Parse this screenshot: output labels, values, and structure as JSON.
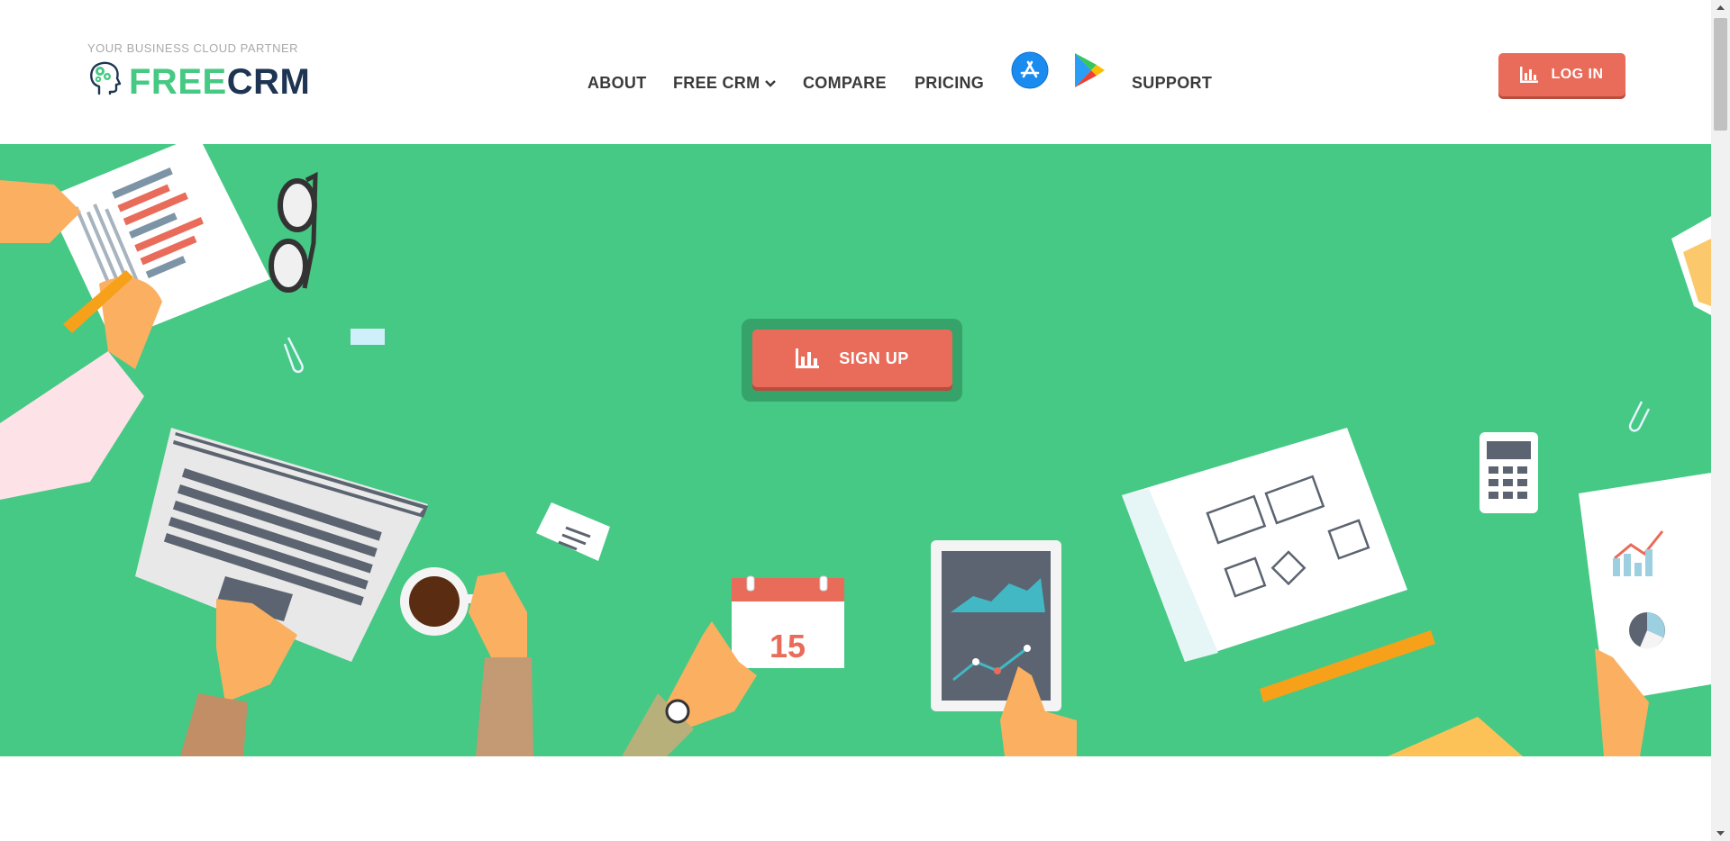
{
  "header": {
    "tagline": "YOUR BUSINESS CLOUD PARTNER",
    "brand": {
      "free": "FREE",
      "crm": "CRM"
    },
    "nav": {
      "about": "ABOUT",
      "free_crm": "FREE CRM",
      "compare": "COMPARE",
      "pricing": "PRICING",
      "support": "SUPPORT"
    },
    "store_icons": [
      "app-store-icon",
      "google-play-icon"
    ],
    "login_label": "LOG IN"
  },
  "hero": {
    "signup_label": "SIGN UP",
    "calendar_day": "15"
  },
  "colors": {
    "brand_green": "#45c984",
    "accent_red": "#e96b5a",
    "brand_navy": "#1d3553"
  }
}
